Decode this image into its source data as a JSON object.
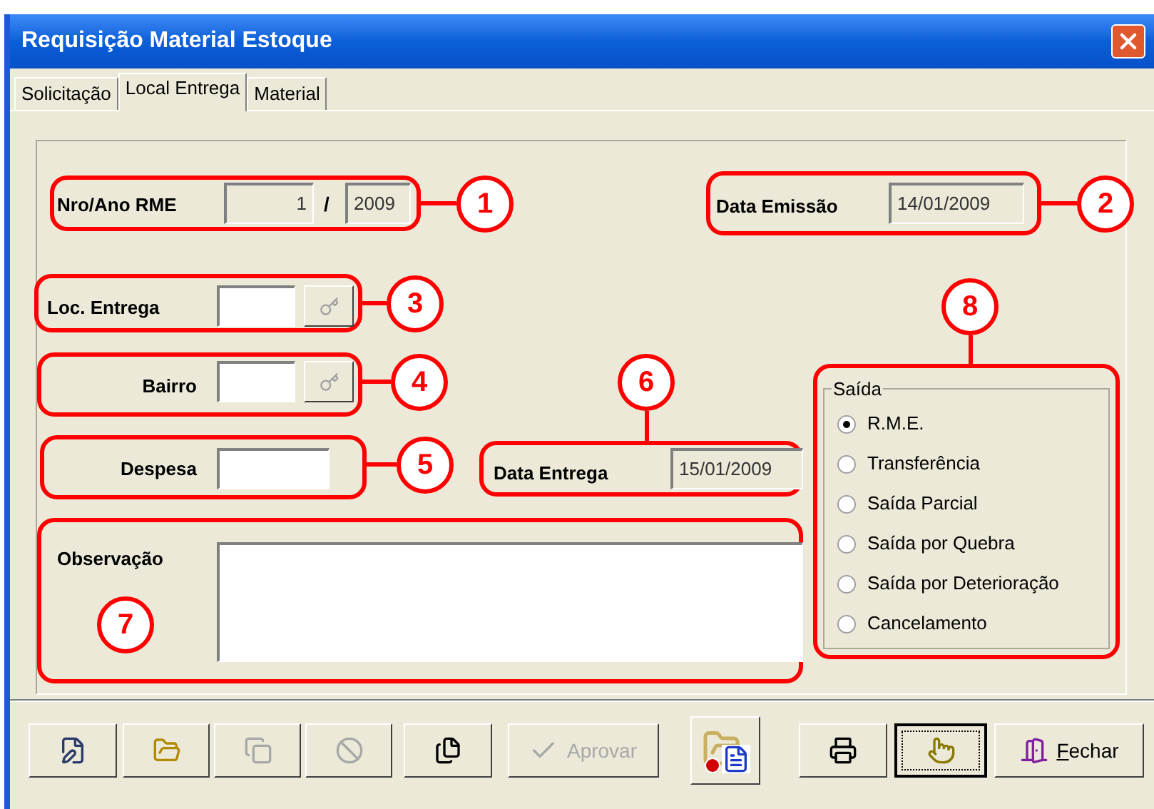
{
  "window": {
    "title": "Requisição Material Estoque"
  },
  "tabs": [
    {
      "label": "Solicitação",
      "selected": false
    },
    {
      "label": "Local Entrega",
      "selected": true
    },
    {
      "label": "Material",
      "selected": false
    }
  ],
  "nro_ano": {
    "label": "Nro/Ano RME",
    "number": "1",
    "separator": "/",
    "year": "2009",
    "disabled": true,
    "callout": "1"
  },
  "data_emissao": {
    "label": "Data Emissão",
    "value": "14/01/2009",
    "disabled": true,
    "callout": "2"
  },
  "loc_entrega": {
    "label": "Loc. Entrega",
    "lookup_disabled": true,
    "callout": "3"
  },
  "bairro": {
    "label": "Bairro",
    "lookup_disabled": true,
    "callout": "4"
  },
  "despesa": {
    "label": "Despesa",
    "callout": "5"
  },
  "data_entrega": {
    "label": "Data Entrega",
    "value": "15/01/2009",
    "disabled": true,
    "callout": "6"
  },
  "observacao": {
    "label": "Observação",
    "callout": "7"
  },
  "saida": {
    "title": "Saída",
    "callout": "8",
    "options": [
      {
        "label": "R.M.E.",
        "selected": true
      },
      {
        "label": "Transferência",
        "selected": false
      },
      {
        "label": "Saída Parcial",
        "selected": false
      },
      {
        "label": "Saída por Quebra",
        "selected": false
      },
      {
        "label": "Saída por Deterioração",
        "selected": false
      },
      {
        "label": "Cancelamento",
        "selected": false
      }
    ]
  },
  "toolbar": [
    {
      "kind": "edit",
      "disabled": false,
      "focused": false
    },
    {
      "kind": "open",
      "disabled": false,
      "focused": false
    },
    {
      "kind": "copy",
      "disabled": true,
      "focused": false
    },
    {
      "kind": "cancel",
      "disabled": true,
      "focused": false
    },
    {
      "kind": "pages",
      "disabled": false,
      "focused": false
    },
    {
      "kind": "approve",
      "label": "Aprovar",
      "mnemonic_underlined": false,
      "disabled": true,
      "focused": false
    },
    {
      "kind": "report",
      "disabled": false,
      "focused": false
    },
    {
      "kind": "print",
      "disabled": false,
      "focused": false
    },
    {
      "kind": "pointer",
      "disabled": false,
      "focused": true
    },
    {
      "kind": "close",
      "label": "Fechar",
      "mnemonic_underlined": true,
      "disabled": false,
      "focused": false
    }
  ]
}
